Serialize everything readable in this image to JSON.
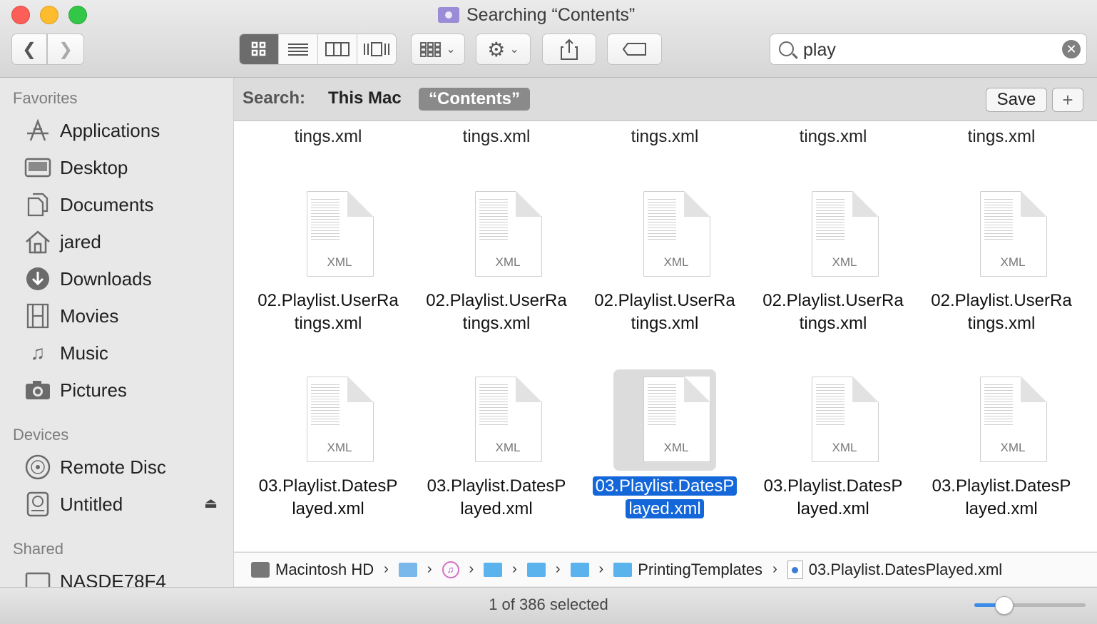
{
  "window": {
    "title": "Searching “Contents”"
  },
  "toolbar": {
    "view_modes": [
      "icon",
      "list",
      "column",
      "cover-flow"
    ],
    "active_view": "icon",
    "search_value": "play"
  },
  "sidebar": {
    "favorites_header": "Favorites",
    "favorites": [
      {
        "label": "Applications",
        "icon": "applications-icon"
      },
      {
        "label": "Desktop",
        "icon": "desktop-icon"
      },
      {
        "label": "Documents",
        "icon": "documents-icon"
      },
      {
        "label": "jared",
        "icon": "home-icon"
      },
      {
        "label": "Downloads",
        "icon": "downloads-icon"
      },
      {
        "label": "Movies",
        "icon": "movies-icon"
      },
      {
        "label": "Music",
        "icon": "music-icon"
      },
      {
        "label": "Pictures",
        "icon": "pictures-icon"
      }
    ],
    "devices_header": "Devices",
    "devices": [
      {
        "label": "Remote Disc",
        "icon": "disc-icon"
      },
      {
        "label": "Untitled",
        "icon": "drive-icon"
      }
    ],
    "shared_header": "Shared",
    "shared": [
      {
        "label": "NASDE78F4",
        "icon": "network-server-icon"
      }
    ]
  },
  "scope": {
    "label": "Search:",
    "option_this_mac": "This Mac",
    "option_selected": "“Contents”",
    "save": "Save",
    "add": "+"
  },
  "files": {
    "top_partial": [
      "tings.xml",
      "tings.xml",
      "tings.xml",
      "tings.xml",
      "tings.xml"
    ],
    "row1": [
      {
        "line1": "02.Playlist.UserRa",
        "line2": "tings.xml",
        "ext": "XML"
      },
      {
        "line1": "02.Playlist.UserRa",
        "line2": "tings.xml",
        "ext": "XML"
      },
      {
        "line1": "02.Playlist.UserRa",
        "line2": "tings.xml",
        "ext": "XML"
      },
      {
        "line1": "02.Playlist.UserRa",
        "line2": "tings.xml",
        "ext": "XML"
      },
      {
        "line1": "02.Playlist.UserRa",
        "line2": "tings.xml",
        "ext": "XML"
      }
    ],
    "row2": [
      {
        "line1": "03.Playlist.DatesP",
        "line2": "layed.xml",
        "ext": "XML"
      },
      {
        "line1": "03.Playlist.DatesP",
        "line2": "layed.xml",
        "ext": "XML"
      },
      {
        "line1": "03.Playlist.DatesP",
        "line2": "layed.xml",
        "ext": "XML"
      },
      {
        "line1": "03.Playlist.DatesP",
        "line2": "layed.xml",
        "ext": "XML"
      },
      {
        "line1": "03.Playlist.DatesP",
        "line2": "layed.xml",
        "ext": "XML"
      }
    ],
    "selected_index": 2
  },
  "pathbar": {
    "root": "Macintosh HD",
    "folder": "PrintingTemplates",
    "file": "03.Playlist.DatesPlayed.xml"
  },
  "status": {
    "text": "1 of 386 selected",
    "icon_size_level": 0.26
  },
  "colors": {
    "selection": "#1467d9",
    "accent": "#3b8be8"
  }
}
